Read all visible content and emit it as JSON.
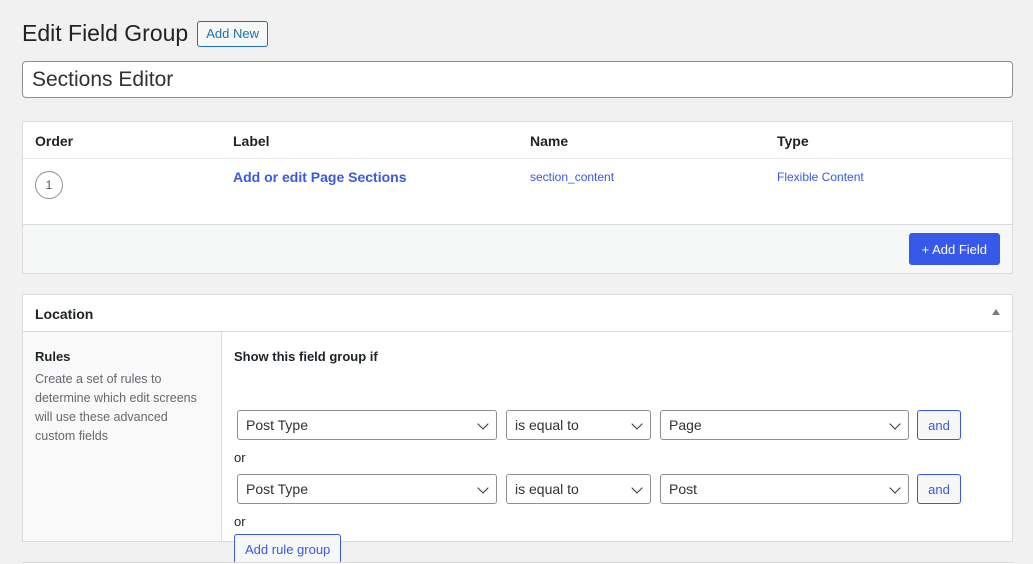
{
  "header": {
    "title": "Edit Field Group",
    "add_new_label": "Add New"
  },
  "title_input": {
    "value": "Sections Editor"
  },
  "fields": {
    "columns": {
      "order": "Order",
      "label": "Label",
      "name": "Name",
      "type": "Type"
    },
    "rows": [
      {
        "order": "1",
        "label": "Add or edit Page Sections",
        "name": "section_content",
        "type": "Flexible Content"
      }
    ],
    "add_field_label": "+ Add Field"
  },
  "location": {
    "title": "Location",
    "rules_title": "Rules",
    "rules_desc": "Create a set of rules to determine which edit screens will use these advanced custom fields",
    "show_label": "Show this field group if",
    "groups": [
      {
        "param": "Post Type",
        "operator": "is equal to",
        "value": "Page",
        "and_label": "and"
      },
      {
        "param": "Post Type",
        "operator": "is equal to",
        "value": "Post",
        "and_label": "and"
      }
    ],
    "or_label": "or",
    "add_rule_group_label": "Add rule group"
  },
  "colors": {
    "accent": "#3858e9",
    "background": "#f1f1f1"
  }
}
